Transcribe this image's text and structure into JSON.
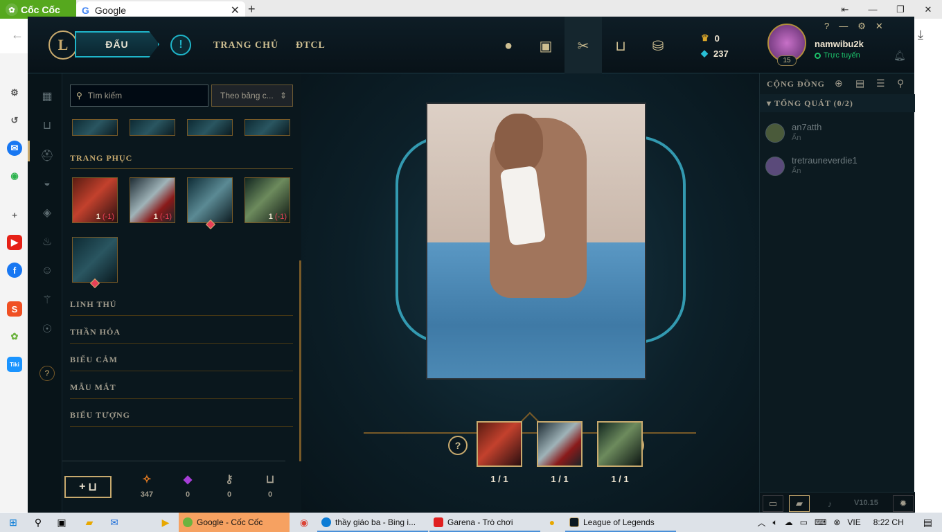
{
  "browser": {
    "logo_text": "Cốc Cốc",
    "tab_title": "Google",
    "new_tab": "+",
    "controls": [
      "⇤",
      "—",
      "❐",
      "✕"
    ]
  },
  "client": {
    "play_label": "ĐẤU",
    "nav": {
      "home": "TRANG CHỦ",
      "tft": "ĐTCL"
    },
    "currency": {
      "rp": "0",
      "be": "237"
    },
    "profile": {
      "name": "namwibu2k",
      "status": "Trực tuyến",
      "level": "15"
    },
    "ctrls": [
      "?",
      "—",
      "⚙",
      "✕"
    ]
  },
  "collection": {
    "search_placeholder": "Tìm kiếm",
    "sort": "Theo bảng c...",
    "skins_title": "TRANG PHỤC",
    "skins": [
      {
        "count": "1",
        "delta": "(-1)"
      },
      {
        "count": "1",
        "delta": "(-1)"
      },
      {
        "count": "",
        "delta": ""
      },
      {
        "count": "1",
        "delta": "(-1)"
      },
      {
        "count": "",
        "delta": ""
      }
    ],
    "sections": [
      "LINH THÚ",
      "THẦN HỎA",
      "BIỂU CẢM",
      "MẪU MẮT",
      "BIỂU TƯỢNG"
    ],
    "add_label": "+",
    "balances": [
      {
        "icon": "orange-essence-icon",
        "value": "347"
      },
      {
        "icon": "mythic-essence-icon",
        "value": "0"
      },
      {
        "icon": "key-icon",
        "value": "0"
      },
      {
        "icon": "chest-icon",
        "value": "0"
      }
    ]
  },
  "center": {
    "help": "?",
    "close": "✕",
    "slots": [
      "1 / 1",
      "1 / 1",
      "1 / 1"
    ]
  },
  "social": {
    "title": "CỘNG ĐỒNG",
    "group": "TỔNG QUÁT (0/2)",
    "friends": [
      {
        "name": "an7atth",
        "status": "Ẩn"
      },
      {
        "name": "tretrauneverdie1",
        "status": "Ẩn"
      }
    ],
    "version": "V10.15"
  },
  "taskbar": {
    "items": [
      {
        "label": "Google - Cốc Cốc"
      },
      {
        "label": "thầy giáo ba - Bing i..."
      },
      {
        "label": "Garena - Trò chơi"
      },
      {
        "label": "League of Legends"
      }
    ],
    "lang": "VIE",
    "time": "8:22 CH"
  },
  "colors": {
    "gold": "#c8aa6e",
    "teal": "#1fb5c9",
    "online": "#1cc26b",
    "bg": "#0b1a22"
  }
}
